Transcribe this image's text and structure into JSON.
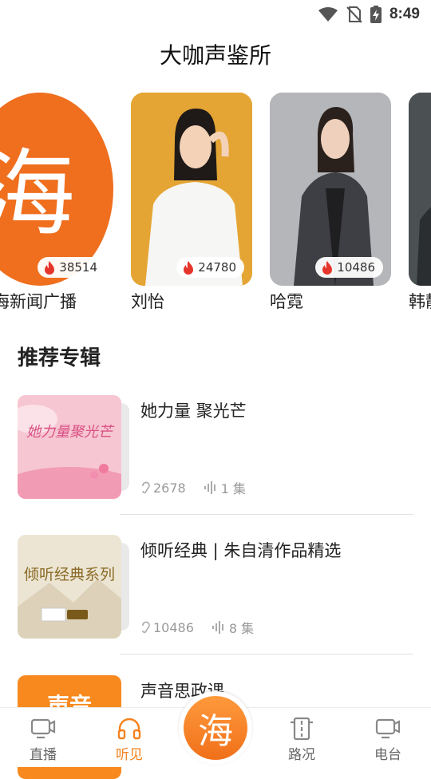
{
  "status_bar": {
    "time": "8:49"
  },
  "page_title": "大咖声鉴所",
  "hosts": [
    {
      "name": "上海新闻广播",
      "listen_count": "38514",
      "avatar": "logo-hai"
    },
    {
      "name": "刘怡",
      "listen_count": "24780",
      "avatar": "woman-white-shirt"
    },
    {
      "name": "哈霓",
      "listen_count": "10486",
      "avatar": "woman-dark-blazer"
    },
    {
      "name": "韩静",
      "listen_count": "",
      "avatar": "partial"
    }
  ],
  "section_title": "推荐专辑",
  "albums": [
    {
      "title": "她力量 聚光芒",
      "plays": "2678",
      "episodes": "1 集",
      "cover_text": "她力量聚光芒"
    },
    {
      "title": "倾听经典 | 朱自清作品精选",
      "plays": "10486",
      "episodes": "8 集",
      "cover_text": "倾听经典系列"
    },
    {
      "title": "声音思政课",
      "plays": "",
      "episodes": "",
      "cover_text": "声音"
    }
  ],
  "tabs": [
    {
      "label": "直播",
      "icon": "tv-icon",
      "active": false
    },
    {
      "label": "听见",
      "icon": "headphones-icon",
      "active": true
    },
    {
      "label": "路况",
      "icon": "traffic-icon",
      "active": false
    },
    {
      "label": "电台",
      "icon": "radio-icon",
      "active": false
    }
  ],
  "center_button": {
    "glyph": "海"
  },
  "colors": {
    "accent": "#f5821f",
    "flame": "#e5352b",
    "text": "#222222",
    "meta": "#999999"
  }
}
